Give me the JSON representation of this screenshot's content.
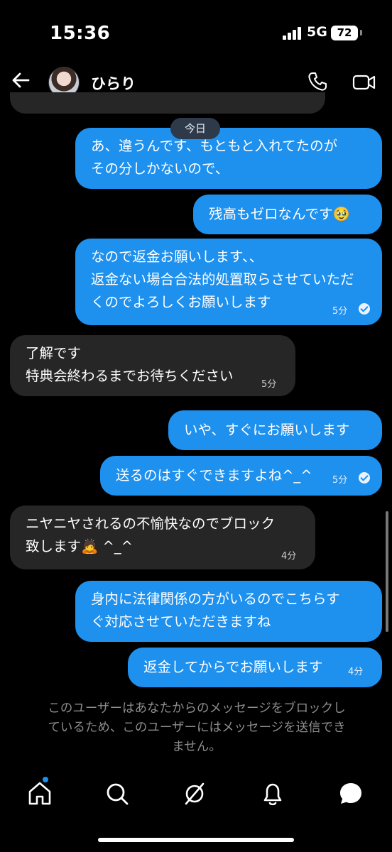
{
  "status_bar": {
    "time": "15:36",
    "network": "5G",
    "battery": "72"
  },
  "header": {
    "contact_name": "ひらり"
  },
  "chat": {
    "date_separator": "今日",
    "messages": [
      {
        "direction": "out",
        "text": "あ、違うんです、もともと入れてたのが\nその分しかないので、",
        "time": ""
      },
      {
        "direction": "out",
        "text": "残高もゼロなんです🥹",
        "time": ""
      },
      {
        "direction": "out",
        "text": "なので返金お願いします、、\n返金ない場合合法的処置取らさせていただ\nくのでよろしくお願いします",
        "time": "5分",
        "read": true
      },
      {
        "direction": "in",
        "text": "了解です\n特典会終わるまでお待ちください",
        "time": "5分"
      },
      {
        "direction": "out",
        "text": "いや、すぐにお願いします",
        "time": ""
      },
      {
        "direction": "out",
        "text": "送るのはすぐできますよね^_^",
        "time": "5分",
        "read": true
      },
      {
        "direction": "in",
        "text": "ニヤニヤされるの不愉快なのでブロック\n致します🙇 ^_^",
        "time": "4分"
      },
      {
        "direction": "out",
        "text": "身内に法律関係の方がいるのでこちらす\nぐ対応させていただきますね",
        "time": ""
      },
      {
        "direction": "out",
        "text": "返金してからでお願いします",
        "time": "4分"
      }
    ],
    "blocked_notice": "このユーザーはあなたからのメッセージをブロックし\nているため、このユーザーにはメッセージを送信でき\nません。"
  },
  "bottom_nav": {
    "items": [
      "home-icon",
      "search-icon",
      "explore-icon",
      "notifications-icon",
      "messages-icon"
    ],
    "active": "messages-icon"
  },
  "colors": {
    "outgoing_bubble": "#1e90ee",
    "incoming_bubble": "#262626",
    "background": "#000000",
    "notice_text": "#8d8d8d"
  }
}
